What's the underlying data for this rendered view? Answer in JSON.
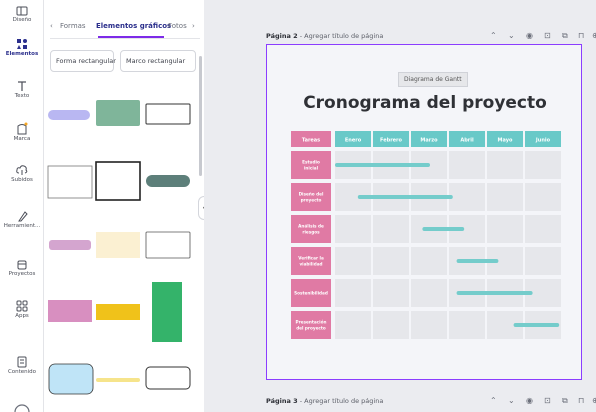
{
  "sidebar": {
    "items": [
      {
        "label": "Diseño",
        "icon": "layout-icon"
      },
      {
        "label": "Elementos",
        "icon": "elements-icon"
      },
      {
        "label": "Texto",
        "icon": "text-icon"
      },
      {
        "label": "Marca",
        "icon": "brand-icon"
      },
      {
        "label": "Subidos",
        "icon": "upload-icon"
      },
      {
        "label": "Herramient...",
        "icon": "draw-icon"
      },
      {
        "label": "Proyectos",
        "icon": "folder-icon"
      },
      {
        "label": "Apps",
        "icon": "apps-icon"
      },
      {
        "label": "Contenido",
        "icon": "content-icon"
      }
    ]
  },
  "panel": {
    "tabs": [
      "Formas",
      "Elementos gráficos",
      "Fotos"
    ],
    "chips": [
      "Forma rectangular",
      "Marco rectangular"
    ],
    "arrow_left": "‹",
    "arrow_right": "›",
    "collapse": "‹"
  },
  "pages": [
    {
      "label": "Página 2",
      "title_placeholder": "Agregar título de página"
    },
    {
      "label": "Página 3",
      "title_placeholder": "Agregar título de página"
    }
  ],
  "gantt": {
    "tag": "Diagrama de Gantt",
    "title": "Cronograma del proyecto",
    "header_task": "Tareas",
    "months": [
      "Enero",
      "Febrero",
      "Marzo",
      "Abril",
      "Mayo",
      "Junio"
    ],
    "tasks": [
      {
        "label": "Estudio inicial",
        "start": 0.0,
        "end": 2.5
      },
      {
        "label": "Diseño del proyecto",
        "start": 0.6,
        "end": 3.1
      },
      {
        "label": "Análisis de riesgos",
        "start": 2.3,
        "end": 3.4
      },
      {
        "label": "Verificar la viabilidad",
        "start": 3.2,
        "end": 4.3
      },
      {
        "label": "Sostenibilidad",
        "start": 3.2,
        "end": 5.2
      },
      {
        "label": "Presentación del proyecto",
        "start": 4.7,
        "end": 5.9
      }
    ]
  },
  "colors": {
    "accent": "#8b3dff",
    "task_pink": "#e07aa4",
    "month_teal": "#69c9c8",
    "bar_teal": "#74cccb",
    "cell": "#e6e7eb"
  }
}
